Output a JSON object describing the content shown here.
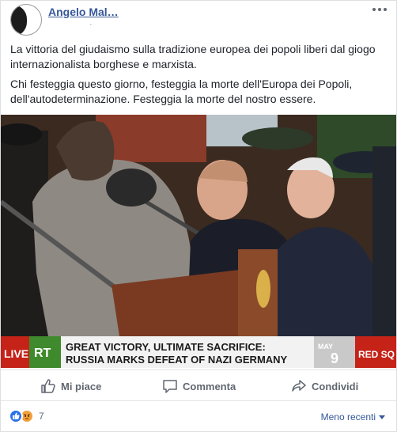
{
  "post": {
    "author": "Angelo Mal…",
    "meta": "·",
    "paragraphs": [
      "La vittoria del giudaismo sulla tradizione europea dei popoli liberi dal giogo internazionalista borghese e marxista.",
      "Chi festeggia questo giorno, festeggia la morte dell'Europa dei Popoli, dell'autodeterminazione. Festeggia la morte del nostro essere."
    ]
  },
  "photo": {
    "live_label": "LIVE",
    "channel_logo": "RT",
    "headline_line1": "GREAT VICTORY, ULTIMATE SACRIFICE:",
    "headline_line2": "RUSSIA MARKS DEFEAT OF NAZI GERMANY",
    "right_month": "MAY",
    "right_day": "9",
    "right_label": "RED SQ",
    "colors": {
      "ticker_green": "#3f8a2c",
      "ticker_red": "#c52318"
    }
  },
  "actions": {
    "like": "Mi piace",
    "comment": "Commenta",
    "share": "Condividi"
  },
  "footer": {
    "reaction_count": "7",
    "sort_label": "Meno recenti",
    "reaction_icons": [
      "like-icon",
      "angry-icon"
    ]
  }
}
